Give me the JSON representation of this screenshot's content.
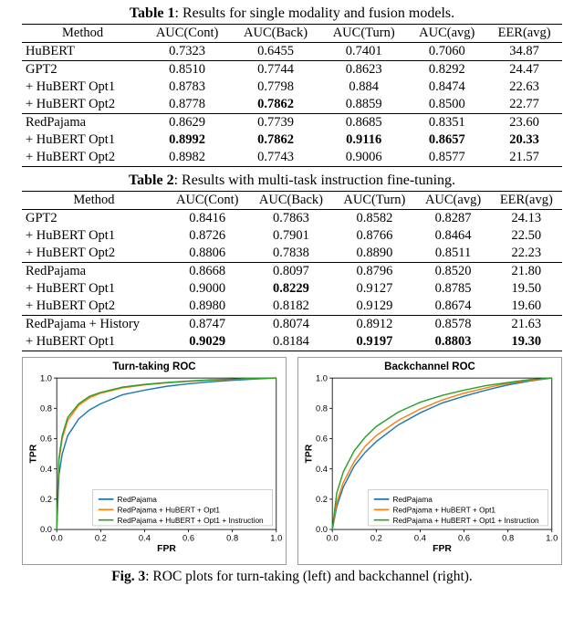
{
  "table1": {
    "caption_label": "Table 1",
    "caption_text": ": Results for single modality and fusion models.",
    "headers": [
      "Method",
      "AUC(Cont)",
      "AUC(Back)",
      "AUC(Turn)",
      "AUC(avg)",
      "EER(avg)"
    ],
    "groups": [
      {
        "rows": [
          {
            "method": "HuBERT",
            "cells": [
              "0.7323",
              "0.6455",
              "0.7401",
              "0.7060",
              "34.87"
            ],
            "bold": [
              false,
              false,
              false,
              false,
              false
            ]
          }
        ]
      },
      {
        "rows": [
          {
            "method": "GPT2",
            "cells": [
              "0.8510",
              "0.7744",
              "0.8623",
              "0.8292",
              "24.47"
            ],
            "bold": [
              false,
              false,
              false,
              false,
              false
            ]
          },
          {
            "method": "+ HuBERT Opt1",
            "cells": [
              "0.8783",
              "0.7798",
              "0.884",
              "0.8474",
              "22.63"
            ],
            "bold": [
              false,
              false,
              false,
              false,
              false
            ]
          },
          {
            "method": "+ HuBERT Opt2",
            "cells": [
              "0.8778",
              "0.7862",
              "0.8859",
              "0.8500",
              "22.77"
            ],
            "bold": [
              false,
              true,
              false,
              false,
              false
            ]
          }
        ]
      },
      {
        "rows": [
          {
            "method": "RedPajama",
            "cells": [
              "0.8629",
              "0.7739",
              "0.8685",
              "0.8351",
              "23.60"
            ],
            "bold": [
              false,
              false,
              false,
              false,
              false
            ]
          },
          {
            "method": "+ HuBERT Opt1",
            "cells": [
              "0.8992",
              "0.7862",
              "0.9116",
              "0.8657",
              "20.33"
            ],
            "bold": [
              true,
              true,
              true,
              true,
              true
            ]
          },
          {
            "method": "+ HuBERT Opt2",
            "cells": [
              "0.8982",
              "0.7743",
              "0.9006",
              "0.8577",
              "21.57"
            ],
            "bold": [
              false,
              false,
              false,
              false,
              false
            ]
          }
        ]
      }
    ]
  },
  "table2": {
    "caption_label": "Table 2",
    "caption_text": ": Results with multi-task instruction fine-tuning.",
    "headers": [
      "Method",
      "AUC(Cont)",
      "AUC(Back)",
      "AUC(Turn)",
      "AUC(avg)",
      "EER(avg)"
    ],
    "groups": [
      {
        "rows": [
          {
            "method": "GPT2",
            "cells": [
              "0.8416",
              "0.7863",
              "0.8582",
              "0.8287",
              "24.13"
            ],
            "bold": [
              false,
              false,
              false,
              false,
              false
            ]
          },
          {
            "method": "+ HuBERT Opt1",
            "cells": [
              "0.8726",
              "0.7901",
              "0.8766",
              "0.8464",
              "22.50"
            ],
            "bold": [
              false,
              false,
              false,
              false,
              false
            ]
          },
          {
            "method": "+ HuBERT Opt2",
            "cells": [
              "0.8806",
              "0.7838",
              "0.8890",
              "0.8511",
              "22.23"
            ],
            "bold": [
              false,
              false,
              false,
              false,
              false
            ]
          }
        ]
      },
      {
        "rows": [
          {
            "method": "RedPajama",
            "cells": [
              "0.8668",
              "0.8097",
              "0.8796",
              "0.8520",
              "21.80"
            ],
            "bold": [
              false,
              false,
              false,
              false,
              false
            ]
          },
          {
            "method": "+ HuBERT Opt1",
            "cells": [
              "0.9000",
              "0.8229",
              "0.9127",
              "0.8785",
              "19.50"
            ],
            "bold": [
              false,
              true,
              false,
              false,
              false
            ]
          },
          {
            "method": "+ HuBERT Opt2",
            "cells": [
              "0.8980",
              "0.8182",
              "0.9129",
              "0.8674",
              "19.60"
            ],
            "bold": [
              false,
              false,
              false,
              false,
              false
            ]
          }
        ]
      },
      {
        "rows": [
          {
            "method": "RedPajama + History",
            "cells": [
              "0.8747",
              "0.8074",
              "0.8912",
              "0.8578",
              "21.63"
            ],
            "bold": [
              false,
              false,
              false,
              false,
              false
            ]
          },
          {
            "method": "+ HuBERT Opt1",
            "cells": [
              "0.9029",
              "0.8184",
              "0.9197",
              "0.8803",
              "19.30"
            ],
            "bold": [
              true,
              false,
              true,
              true,
              true
            ]
          }
        ]
      }
    ]
  },
  "chart_data": [
    {
      "type": "line",
      "title": "Turn-taking ROC",
      "xlabel": "FPR",
      "ylabel": "TPR",
      "xlim": [
        0,
        1
      ],
      "ylim": [
        0,
        1
      ],
      "xticks": [
        0.0,
        0.2,
        0.4,
        0.6,
        0.8,
        1.0
      ],
      "yticks": [
        0.0,
        0.2,
        0.4,
        0.6,
        0.8,
        1.0
      ],
      "legend_pos": "lower-right",
      "series": [
        {
          "name": "RedPajama",
          "color": "#1f77b4",
          "points": [
            [
              0,
              0
            ],
            [
              0.01,
              0.36
            ],
            [
              0.025,
              0.5
            ],
            [
              0.05,
              0.62
            ],
            [
              0.1,
              0.73
            ],
            [
              0.15,
              0.79
            ],
            [
              0.2,
              0.83
            ],
            [
              0.3,
              0.89
            ],
            [
              0.4,
              0.92
            ],
            [
              0.5,
              0.945
            ],
            [
              0.6,
              0.962
            ],
            [
              0.7,
              0.975
            ],
            [
              0.8,
              0.985
            ],
            [
              0.9,
              0.993
            ],
            [
              1,
              1
            ]
          ]
        },
        {
          "name": "RedPajama + HuBERT + Opt1",
          "color": "#ff7f0e",
          "points": [
            [
              0,
              0
            ],
            [
              0.01,
              0.45
            ],
            [
              0.025,
              0.6
            ],
            [
              0.05,
              0.72
            ],
            [
              0.1,
              0.82
            ],
            [
              0.15,
              0.87
            ],
            [
              0.2,
              0.9
            ],
            [
              0.3,
              0.935
            ],
            [
              0.4,
              0.955
            ],
            [
              0.5,
              0.968
            ],
            [
              0.6,
              0.978
            ],
            [
              0.7,
              0.986
            ],
            [
              0.8,
              0.992
            ],
            [
              0.9,
              0.997
            ],
            [
              1,
              1
            ]
          ]
        },
        {
          "name": "RedPajama + HuBERT + Opt1 + Instruction",
          "color": "#2ca02c",
          "points": [
            [
              0,
              0
            ],
            [
              0.01,
              0.47
            ],
            [
              0.025,
              0.62
            ],
            [
              0.05,
              0.74
            ],
            [
              0.1,
              0.83
            ],
            [
              0.15,
              0.88
            ],
            [
              0.2,
              0.905
            ],
            [
              0.3,
              0.94
            ],
            [
              0.4,
              0.958
            ],
            [
              0.5,
              0.97
            ],
            [
              0.6,
              0.98
            ],
            [
              0.7,
              0.988
            ],
            [
              0.8,
              0.993
            ],
            [
              0.9,
              0.998
            ],
            [
              1,
              1
            ]
          ]
        }
      ]
    },
    {
      "type": "line",
      "title": "Backchannel ROC",
      "xlabel": "FPR",
      "ylabel": "TPR",
      "xlim": [
        0,
        1
      ],
      "ylim": [
        0,
        1
      ],
      "xticks": [
        0.0,
        0.2,
        0.4,
        0.6,
        0.8,
        1.0
      ],
      "yticks": [
        0.0,
        0.2,
        0.4,
        0.6,
        0.8,
        1.0
      ],
      "legend_pos": "lower-right",
      "series": [
        {
          "name": "RedPajama",
          "color": "#1f77b4",
          "points": [
            [
              0,
              0
            ],
            [
              0.02,
              0.15
            ],
            [
              0.05,
              0.28
            ],
            [
              0.1,
              0.42
            ],
            [
              0.15,
              0.51
            ],
            [
              0.2,
              0.58
            ],
            [
              0.3,
              0.69
            ],
            [
              0.4,
              0.77
            ],
            [
              0.5,
              0.835
            ],
            [
              0.6,
              0.88
            ],
            [
              0.7,
              0.92
            ],
            [
              0.8,
              0.955
            ],
            [
              0.9,
              0.98
            ],
            [
              1,
              1
            ]
          ]
        },
        {
          "name": "RedPajama + HuBERT + Opt1",
          "color": "#ff7f0e",
          "points": [
            [
              0,
              0
            ],
            [
              0.02,
              0.18
            ],
            [
              0.05,
              0.31
            ],
            [
              0.1,
              0.45
            ],
            [
              0.15,
              0.55
            ],
            [
              0.2,
              0.62
            ],
            [
              0.3,
              0.72
            ],
            [
              0.4,
              0.795
            ],
            [
              0.5,
              0.855
            ],
            [
              0.6,
              0.9
            ],
            [
              0.7,
              0.935
            ],
            [
              0.8,
              0.965
            ],
            [
              0.9,
              0.985
            ],
            [
              1,
              1
            ]
          ]
        },
        {
          "name": "RedPajama + HuBERT + Opt1 + Instruction",
          "color": "#2ca02c",
          "points": [
            [
              0,
              0
            ],
            [
              0.02,
              0.24
            ],
            [
              0.05,
              0.38
            ],
            [
              0.1,
              0.52
            ],
            [
              0.15,
              0.61
            ],
            [
              0.2,
              0.68
            ],
            [
              0.3,
              0.775
            ],
            [
              0.4,
              0.84
            ],
            [
              0.5,
              0.885
            ],
            [
              0.6,
              0.92
            ],
            [
              0.7,
              0.95
            ],
            [
              0.8,
              0.97
            ],
            [
              0.9,
              0.99
            ],
            [
              1,
              1
            ]
          ]
        }
      ]
    }
  ],
  "legend_labels": [
    "RedPajama",
    "RedPajama + HuBERT + Opt1",
    "RedPajama + HuBERT + Opt1 + Instruction"
  ],
  "fig3": {
    "label": "Fig. 3",
    "text": ": ROC plots for turn-taking (left) and backchannel (right)."
  }
}
